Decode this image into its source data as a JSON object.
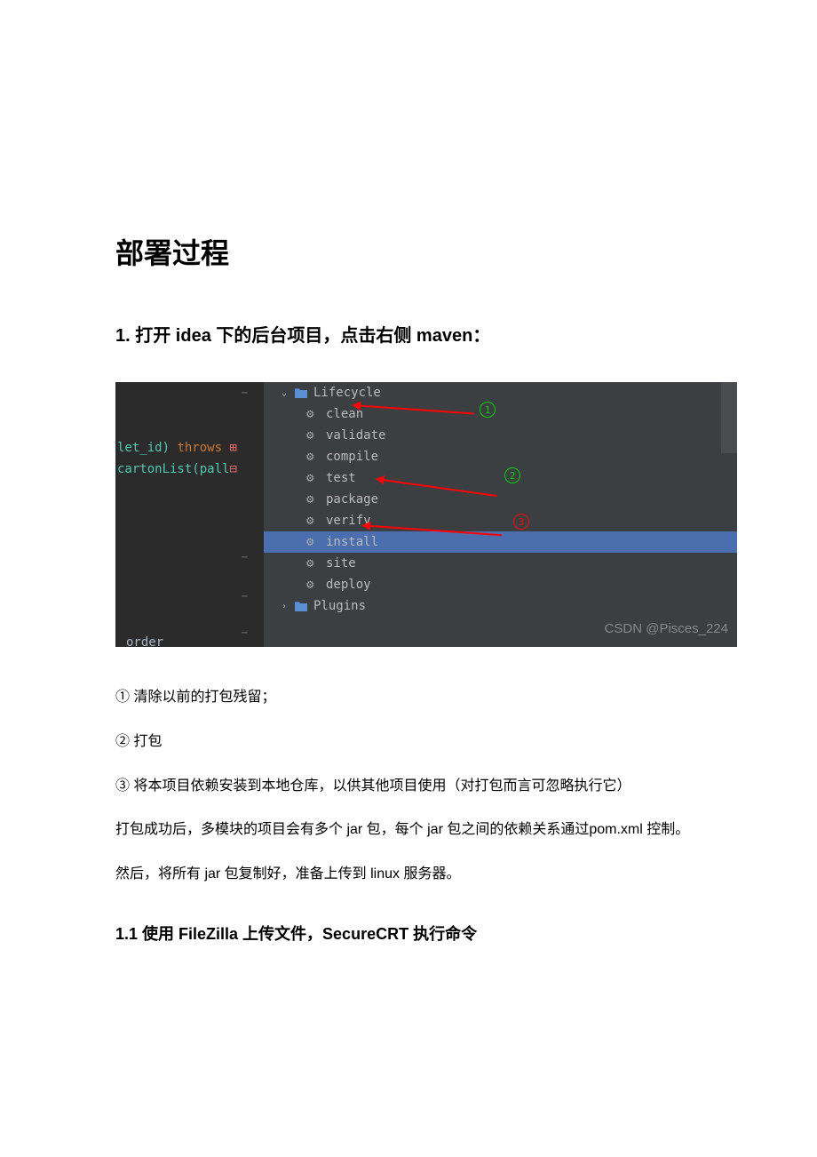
{
  "heading": "部署过程",
  "step1": {
    "title": "1. 打开 idea 下的后台项目，点击右侧 maven："
  },
  "screenshot": {
    "code": {
      "line1_part1": "let_id)",
      "line1_part2": " throws ",
      "line2": "cartonList(pall",
      "bottom": "order"
    },
    "maven_tree": {
      "lifecycle": "Lifecycle",
      "items": [
        "clean",
        "validate",
        "compile",
        "test",
        "package",
        "verify",
        "install",
        "site",
        "deploy"
      ],
      "plugins": "Plugins"
    },
    "annotations": {
      "num1": "1",
      "num2": "2",
      "num3": "3"
    },
    "watermark": "CSDN @Pisces_224"
  },
  "descriptions": {
    "item1": "① 清除以前的打包残留；",
    "item2": "② 打包",
    "item3": "③ 将本项目依赖安装到本地仓库，以供其他项目使用（对打包而言可忽略执行它）",
    "para1": "打包成功后，多模块的项目会有多个 jar 包，每个 jar 包之间的依赖关系通过pom.xml 控制。",
    "para2": "然后，将所有 jar 包复制好，准备上传到 linux 服务器。"
  },
  "step1_1": {
    "title": "1.1 使用 FileZilla 上传文件，SecureCRT 执行命令"
  }
}
